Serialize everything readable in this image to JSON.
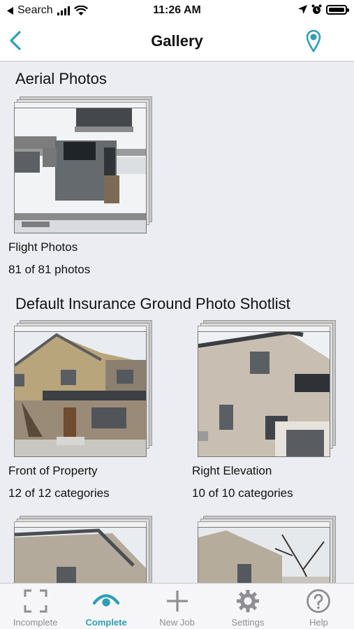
{
  "status_bar": {
    "back_app_label": "Search",
    "time": "11:26 AM"
  },
  "nav": {
    "title": "Gallery",
    "back_icon": "chevron-left-icon",
    "location_icon": "map-pin-icon"
  },
  "colors": {
    "accent": "#2d9fb5",
    "inactive": "#8e8e93",
    "background": "#ecedf2"
  },
  "sections": [
    {
      "title": "Aerial Photos",
      "albums": [
        {
          "name": "Flight Photos",
          "count": "81 of 81 photos"
        }
      ]
    },
    {
      "title": "Default Insurance Ground Photo Shotlist",
      "albums": [
        {
          "name": "Front of Property",
          "count": "12 of 12 categories"
        },
        {
          "name": "Right Elevation",
          "count": "10 of 10 categories"
        },
        {
          "name": "",
          "count": ""
        },
        {
          "name": "",
          "count": ""
        }
      ]
    }
  ],
  "tab_bar": {
    "tabs": [
      {
        "label": "Incomplete",
        "icon": "corners-frame-icon",
        "active": false
      },
      {
        "label": "Complete",
        "icon": "eye-icon",
        "active": true
      },
      {
        "label": "New Job",
        "icon": "plus-icon",
        "active": false
      },
      {
        "label": "Settings",
        "icon": "gear-icon",
        "active": false
      },
      {
        "label": "Help",
        "icon": "question-circle-icon",
        "active": false
      }
    ]
  }
}
